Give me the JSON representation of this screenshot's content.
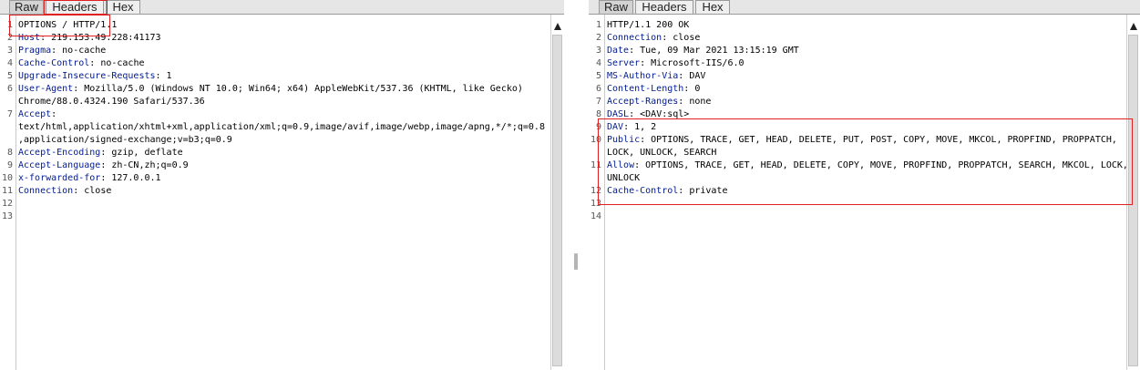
{
  "request": {
    "tabs": [
      {
        "label": "Raw",
        "active": true
      },
      {
        "label": "Headers",
        "active": false
      },
      {
        "label": "Hex",
        "active": false
      }
    ],
    "lines": [
      {
        "num": "1",
        "key": "",
        "text": "OPTIONS / HTTP/1.1"
      },
      {
        "num": "2",
        "key": "Host",
        "text": ": 219.153.49.228:41173"
      },
      {
        "num": "3",
        "key": "Pragma",
        "text": ": no-cache"
      },
      {
        "num": "4",
        "key": "Cache-Control",
        "text": ": no-cache"
      },
      {
        "num": "5",
        "key": "Upgrade-Insecure-Requests",
        "text": ": 1"
      },
      {
        "num": "6",
        "key": "User-Agent",
        "text": ": Mozilla/5.0 (Windows NT 10.0; Win64; x64) AppleWebKit/537.36 (KHTML, like Gecko)"
      },
      {
        "num": "",
        "key": "",
        "text": "Chrome/88.0.4324.190 Safari/537.36"
      },
      {
        "num": "7",
        "key": "Accept",
        "text": ":"
      },
      {
        "num": "",
        "key": "",
        "text": "text/html,application/xhtml+xml,application/xml;q=0.9,image/avif,image/webp,image/apng,*/*;q=0.8"
      },
      {
        "num": "",
        "key": "",
        "text": ",application/signed-exchange;v=b3;q=0.9"
      },
      {
        "num": "8",
        "key": "Accept-Encoding",
        "text": ": gzip, deflate"
      },
      {
        "num": "9",
        "key": "Accept-Language",
        "text": ": zh-CN,zh;q=0.9"
      },
      {
        "num": "10",
        "key": "x-forwarded-for",
        "text": ": 127.0.0.1"
      },
      {
        "num": "11",
        "key": "Connection",
        "text": ": close"
      },
      {
        "num": "12",
        "key": "",
        "text": ""
      },
      {
        "num": "13",
        "key": "",
        "text": ""
      }
    ]
  },
  "response": {
    "tabs": [
      {
        "label": "Raw",
        "active": true
      },
      {
        "label": "Headers",
        "active": false
      },
      {
        "label": "Hex",
        "active": false
      }
    ],
    "lines": [
      {
        "num": "1",
        "key": "",
        "text": "HTTP/1.1 200 OK"
      },
      {
        "num": "2",
        "key": "Connection",
        "text": ": close"
      },
      {
        "num": "3",
        "key": "Date",
        "text": ": Tue, 09 Mar 2021 13:15:19 GMT"
      },
      {
        "num": "4",
        "key": "Server",
        "text": ": Microsoft-IIS/6.0"
      },
      {
        "num": "5",
        "key": "MS-Author-Via",
        "text": ": DAV"
      },
      {
        "num": "6",
        "key": "Content-Length",
        "text": ": 0"
      },
      {
        "num": "7",
        "key": "Accept-Ranges",
        "text": ": none"
      },
      {
        "num": "8",
        "key": "DASL",
        "text": ": <DAV:sql>"
      },
      {
        "num": "9",
        "key": "DAV",
        "text": ": 1, 2"
      },
      {
        "num": "10",
        "key": "Public",
        "text": ": OPTIONS, TRACE, GET, HEAD, DELETE, PUT, POST, COPY, MOVE, MKCOL, PROPFIND, PROPPATCH,"
      },
      {
        "num": "",
        "key": "",
        "text": "LOCK, UNLOCK, SEARCH"
      },
      {
        "num": "11",
        "key": "Allow",
        "text": ": OPTIONS, TRACE, GET, HEAD, DELETE, COPY, MOVE, PROPFIND, PROPPATCH, SEARCH, MKCOL, LOCK,"
      },
      {
        "num": "",
        "key": "",
        "text": "UNLOCK"
      },
      {
        "num": "12",
        "key": "Cache-Control",
        "text": ": private"
      },
      {
        "num": "13",
        "key": "",
        "text": ""
      },
      {
        "num": "14",
        "key": "",
        "text": ""
      }
    ]
  },
  "colors": {
    "header_key": "#001b8f",
    "highlight_box": "#e02020"
  }
}
